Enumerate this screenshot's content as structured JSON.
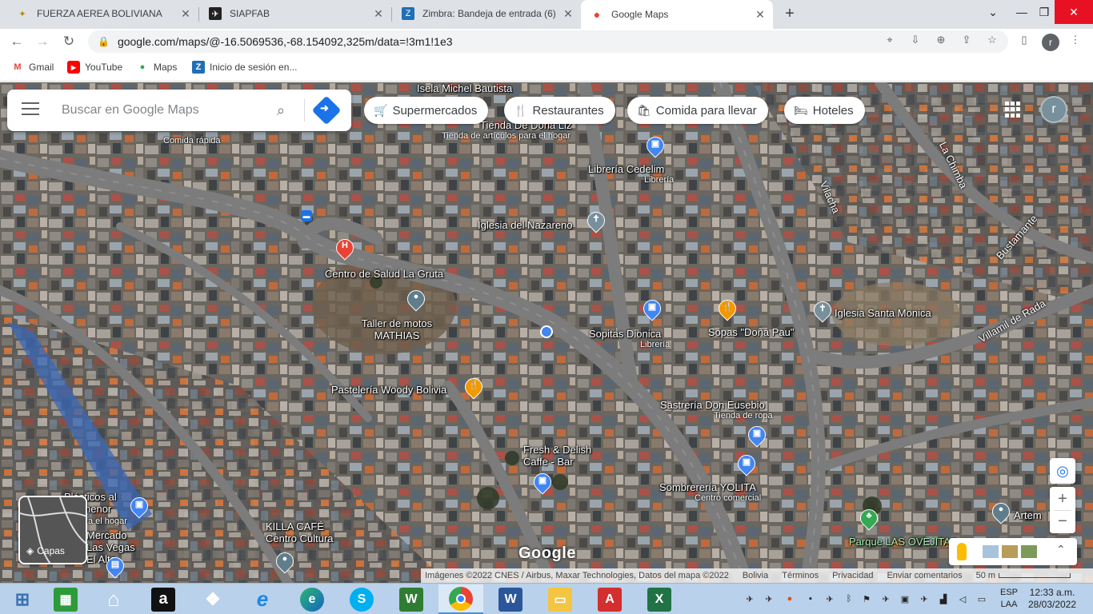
{
  "browser": {
    "tabs": [
      {
        "title": "FUERZA AEREA BOLIVIANA",
        "icon": "fab-eagle-icon"
      },
      {
        "title": "SIAPFAB",
        "icon": "siapfab-icon"
      },
      {
        "title": "Zimbra: Bandeja de entrada (6)",
        "icon": "zimbra-icon",
        "badge": "6"
      },
      {
        "title": "Google Maps",
        "icon": "maps-pin-icon"
      }
    ],
    "active_tab": 3,
    "url": "google.com/maps/@-16.5069536,-68.154092,325m/data=!3m1!1e3",
    "profile_initial": "r",
    "bookmarks": [
      {
        "label": "Gmail",
        "icon": "gmail-icon"
      },
      {
        "label": "YouTube",
        "icon": "youtube-icon"
      },
      {
        "label": "Maps",
        "icon": "maps-icon"
      },
      {
        "label": "Inicio de sesión en...",
        "icon": "zimbra-icon"
      }
    ]
  },
  "maps": {
    "search_placeholder": "Buscar en Google Maps",
    "chips": [
      {
        "label": "Supermercados",
        "icon": "cart-icon"
      },
      {
        "label": "Restaurantes",
        "icon": "restaurant-icon"
      },
      {
        "label": "Comida para llevar",
        "icon": "takeout-icon"
      },
      {
        "label": "Hoteles",
        "icon": "hotel-icon"
      }
    ],
    "avatar_initial": "r",
    "layers_label": "Capas",
    "google_logo": "Google",
    "places": [
      {
        "name": "Isela Michel Bautista",
        "sub": ""
      },
      {
        "name": "Tienda De Doña Liz",
        "sub": "Tienda de artículos para el hogar"
      },
      {
        "name": "",
        "sub": "Comida rápida"
      },
      {
        "name": "Librería Cedelim",
        "sub": "Librería"
      },
      {
        "name": "Iglesia del Nazareno",
        "sub": ""
      },
      {
        "name": "Centro de Salud La Gruta",
        "sub": ""
      },
      {
        "name": "Taller de motos MATHIAS",
        "sub": ""
      },
      {
        "name": "Sopitas Dionica",
        "sub": "Librería"
      },
      {
        "name": "Sopas \"Doña Pau\"",
        "sub": ""
      },
      {
        "name": "Iglesia Santa Monica",
        "sub": ""
      },
      {
        "name": "Pastelería Woody Bolivia",
        "sub": ""
      },
      {
        "name": "Sastrería Don Eusebio",
        "sub": "Tienda de ropa"
      },
      {
        "name": "Fresh & Delish Caffe - Bar",
        "sub": ""
      },
      {
        "name": "Sombrerería YOLITA",
        "sub": "Centro comercial"
      },
      {
        "name": "Plásticos al por menor",
        "sub": "a el hogar"
      },
      {
        "name": "Mercado Las Vegas El Alto",
        "sub": ""
      },
      {
        "name": "KILLA CAFÉ Centro Cultura",
        "sub": ""
      },
      {
        "name": "Parque LAS OVEJITAS",
        "sub": ""
      },
      {
        "name": "Artem",
        "sub": ""
      }
    ],
    "streets": [
      "La Chimba",
      "Vilacha",
      "Bustamante",
      "Villamil de Rada"
    ],
    "attribution": {
      "imagery": "Imágenes ©2022 CNES / Airbus, Maxar Technologies, Datos del mapa ©2022",
      "country": "Bolivia",
      "terms": "Términos",
      "privacy": "Privacidad",
      "feedback": "Enviar comentarios",
      "scale": "50 m"
    }
  },
  "taskbar": {
    "apps": [
      "windows-start",
      "store",
      "home",
      "amazon",
      "dropbox",
      "internet-explorer",
      "edge",
      "skype",
      "wps",
      "chrome",
      "word",
      "file-explorer",
      "acrobat",
      "excel"
    ],
    "active_app": "chrome",
    "language": "ESP",
    "layout": "LAA",
    "time": "12:33 a.m.",
    "date": "28/03/2022"
  },
  "colors": {
    "tabstrip": "#dee1e6",
    "accent_blue": "#1a73e8",
    "taskbar": "#b9d1ea"
  }
}
